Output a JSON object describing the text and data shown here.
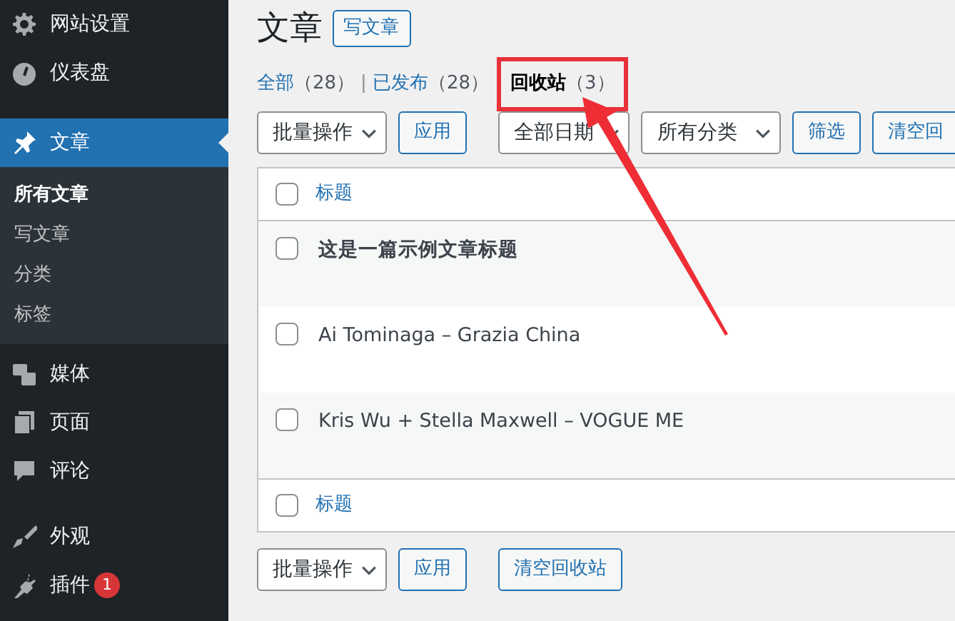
{
  "sidebar": {
    "items": [
      {
        "label": "网站设置",
        "selected": false
      },
      {
        "label": "仪表盘",
        "selected": false
      },
      {
        "label": "文章",
        "selected": true,
        "children": [
          {
            "label": "所有文章",
            "selected": true
          },
          {
            "label": "写文章",
            "selected": false
          },
          {
            "label": "分类",
            "selected": false
          },
          {
            "label": "标签",
            "selected": false
          }
        ]
      },
      {
        "label": "媒体",
        "selected": false
      },
      {
        "label": "页面",
        "selected": false
      },
      {
        "label": "评论",
        "selected": false
      },
      {
        "label": "外观",
        "selected": false
      },
      {
        "label": "插件",
        "selected": false,
        "badge": "1"
      }
    ]
  },
  "page": {
    "title": "文章",
    "add_button": "写文章"
  },
  "tabs": [
    {
      "label": "全部",
      "count": "（28）",
      "selected": false
    },
    {
      "label": "已发布",
      "count": "（28）",
      "selected": false
    },
    {
      "label": "回收站",
      "count": "（3）",
      "selected": true
    }
  ],
  "separators": [
    "|"
  ],
  "top_toolbar": {
    "bulk_action": "批量操作",
    "apply": "应用",
    "date_filter": "全部日期",
    "category_filter": "所有分类",
    "filter": "筛选",
    "empty_trash": "清空回"
  },
  "table": {
    "header": {
      "label": "标题",
      "checked": false
    },
    "rows": [
      {
        "title": "这是一篇示例文章标题",
        "checked": false,
        "bold": true
      },
      {
        "title": "Ai Tominaga – Grazia China",
        "checked": false,
        "bold": false
      },
      {
        "title": "Kris Wu + Stella Maxwell – VOGUE ME",
        "checked": false,
        "bold": false
      }
    ],
    "footer": {
      "label": "标题",
      "checked": false
    }
  },
  "bottom_toolbar": {
    "bulk_action": "批量操作",
    "apply": "应用",
    "empty_trash": "清空回收站"
  }
}
